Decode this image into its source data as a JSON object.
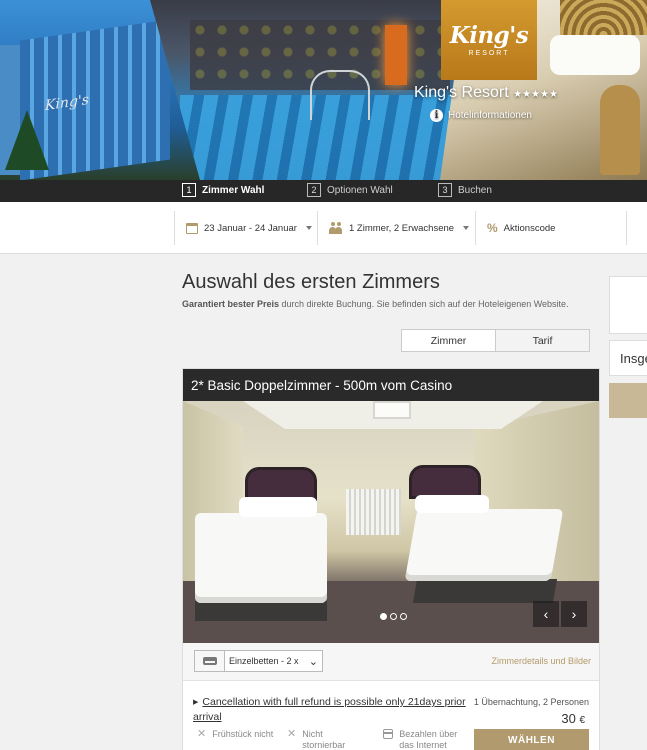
{
  "hero": {
    "logo_name": "King's",
    "logo_sub": "RESORT",
    "building_sign": "King's",
    "hotel_name": "King's Resort",
    "stars": "★★★★★",
    "info_label": "Hotelinformationen"
  },
  "steps": [
    {
      "num": "1",
      "label": "Zimmer Wahl",
      "active": true
    },
    {
      "num": "2",
      "label": "Optionen Wahl",
      "active": false
    },
    {
      "num": "3",
      "label": "Buchen",
      "active": false
    }
  ],
  "search": {
    "dates": "23 Januar - 24 Januar",
    "guests": "1 Zimmer, 2 Erwachsene",
    "promo": "Aktionscode"
  },
  "main": {
    "title": "Auswahl des ersten Zimmers",
    "subtitle_bold": "Garantiert bester Preis",
    "subtitle_rest": " durch direkte Buchung. Sie befinden sich auf der Hoteleigenen Website.",
    "toggle_room": "Zimmer",
    "toggle_rate": "Tarif"
  },
  "room": {
    "name": "2* Basic Doppelzimmer - 500m vom Casino",
    "photo_count": 3,
    "photo_active": 1,
    "bed_select": "Einzelbetten - 2 x",
    "details_link": "Zimmerdetails und Bilder",
    "cancellation": "Cancellation with full refund is possible only 21days prior arrival",
    "nights": "1 Übernachtung, 2 Personen",
    "price": "30",
    "currency": "€",
    "features": [
      "Frühstück nicht",
      "Nicht stornierbar",
      "Bezahlen über das Internet"
    ],
    "book_label": "WÄHLEN"
  },
  "sidebar": {
    "total_label": "Insgesamt"
  },
  "colors": {
    "accent": "#b09a6e",
    "dark_bar": "#272727",
    "logo_gold": "#d49a2f"
  }
}
